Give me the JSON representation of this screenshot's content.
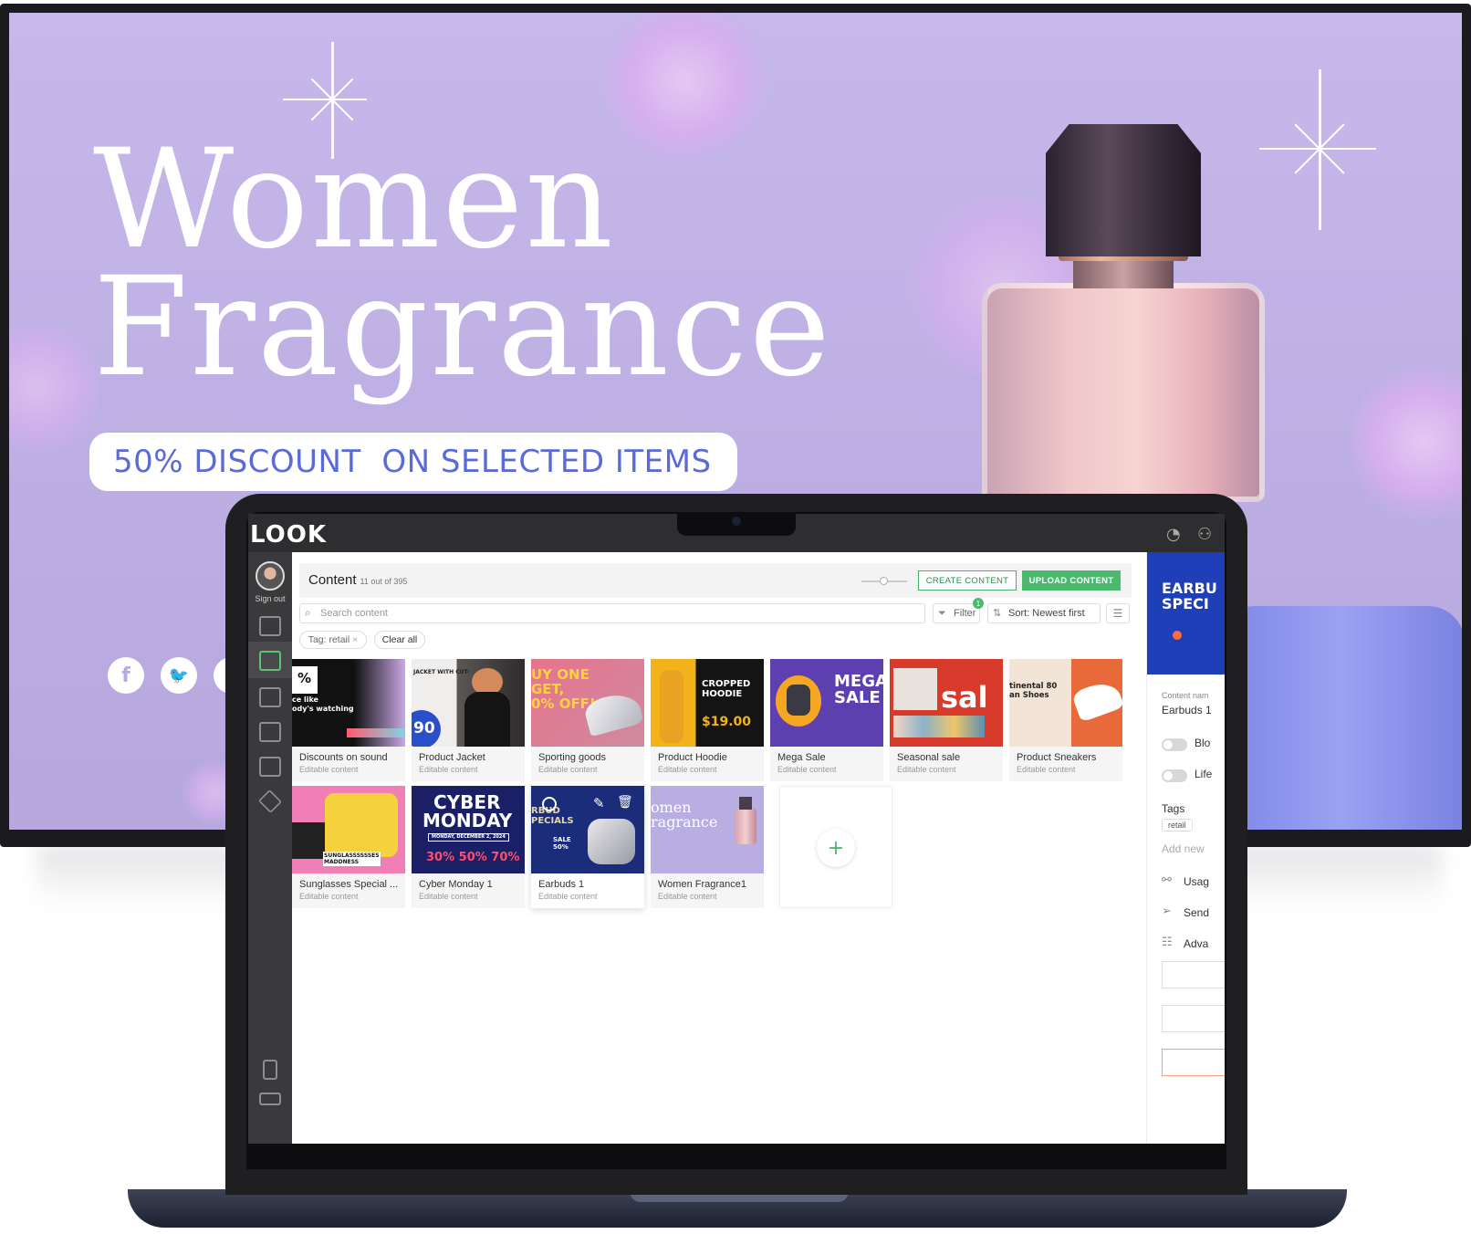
{
  "promo": {
    "title_line1": "Women",
    "title_line2": "Fragrance",
    "discount": "50% DISCOUNT  ON SELECTED ITEMS",
    "social": [
      "facebook-icon",
      "twitter-icon",
      "instagram-icon"
    ],
    "colors": {
      "background": "#c2b4e8",
      "accent_text": "#5a6ad6"
    }
  },
  "app": {
    "logo": "LOOK",
    "sidebar": {
      "sign_out": "Sign out"
    },
    "content": {
      "title": "Content",
      "count": "11 out of 395",
      "create_button": "CREATE CONTENT",
      "upload_button": "UPLOAD CONTENT",
      "search_placeholder": "Search content",
      "filter_label": "Filter",
      "filter_badge": "1",
      "sort_label": "Sort: Newest first",
      "tag_chip": "Tag: retail",
      "clear_all": "Clear all"
    },
    "cards": [
      {
        "title": "Discounts on sound",
        "subtitle": "Editable content"
      },
      {
        "title": "Product Jacket",
        "subtitle": "Editable content"
      },
      {
        "title": "Sporting goods",
        "subtitle": "Editable content"
      },
      {
        "title": "Product Hoodie",
        "subtitle": "Editable content"
      },
      {
        "title": "Mega Sale",
        "subtitle": "Editable content"
      },
      {
        "title": "Seasonal sale",
        "subtitle": "Editable content"
      },
      {
        "title": "Product Sneakers",
        "subtitle": "Editable content"
      },
      {
        "title": "Sunglasses Special ...",
        "subtitle": "Editable content"
      },
      {
        "title": "Cyber Monday 1",
        "subtitle": "Editable content"
      },
      {
        "title": "Earbuds 1",
        "subtitle": "Editable content"
      },
      {
        "title": "Women Fragrance1",
        "subtitle": "Editable content"
      }
    ],
    "thumb_text": {
      "t1_pct": "%",
      "t1_line": "ce like\nody's watching",
      "t2_top": "JACKET WITH CUT-",
      "t2_num": "90",
      "t3": "UY ONE\nGET,\n0% OFF!",
      "t4_title": "CROPPED\nHOODIE",
      "t4_price": "$19.00",
      "t5": "MEGA\nSALE",
      "t6": "sal",
      "t7": "tinental 80\nan Shoes",
      "t8": "SUNGLASSSSSSES\nMADDNESS",
      "t9_line1": "CYBER",
      "t9_line2": "MONDAY",
      "t9_date": "MONDAY, DECEMBER 2, 2024",
      "t9_pcts": "30% 50% 70%",
      "t10": "RBUD\nPECIALS",
      "t10_sale": "SALE\n50%",
      "t11": "omen\nragrance"
    },
    "right_panel": {
      "preview_text": "EARBU\nSPECI",
      "content_name_label": "Content nam",
      "content_name_value": "Earbuds 1",
      "toggle1": "Blo",
      "toggle2": "Life",
      "tags_label": "Tags",
      "tag": "retail",
      "add_new": "Add new",
      "usage": "Usag",
      "send": "Send",
      "advanced": "Adva"
    },
    "colors": {
      "accent": "#4cba6e",
      "topbar": "#2e2e30",
      "sidebar": "#3a3a3c"
    }
  }
}
